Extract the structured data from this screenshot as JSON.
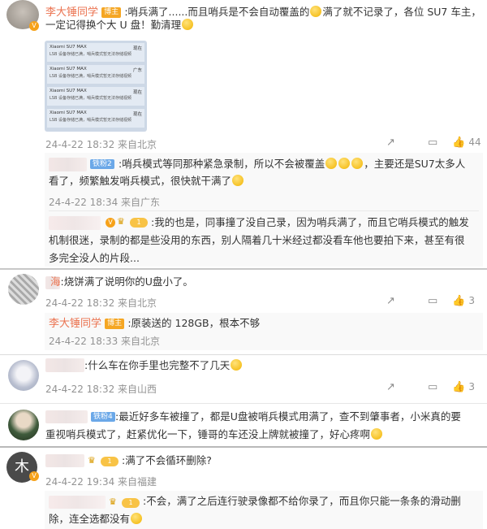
{
  "c1": {
    "name": "李大锤同学",
    "badge": "博主",
    "text_line1": ":哨兵满了......而且哨兵是不会自动覆盖的",
    "text_line1b": "满了就不记录了，各位 SU7 车主，",
    "text_line2": "一定记得换个大 U 盘！勤清理",
    "thumb": {
      "rows": [
        {
          "title": "Xiaomi SU7 MAX",
          "tag": "现在",
          "detail": "LSB 设备存储已满，哨兵模式暂无法存储视频"
        },
        {
          "title": "Xiaomi SU7 MAX",
          "tag": "广东",
          "detail": "LSB 设备存储已满，哨兵模式暂无法存储视频"
        },
        {
          "title": "Xiaomi SU7 MAX",
          "tag": "现在",
          "detail": "LSB 设备存储已满，哨兵模式暂无法存储视频"
        },
        {
          "title": "Xiaomi SU7 MAX",
          "tag": "现在",
          "detail": "LSB 设备存储已满，哨兵模式暂无法存储视频"
        }
      ]
    },
    "time": "24-4-22 18:32 来自北京",
    "likes": "44"
  },
  "r1": {
    "fan_badge": "铁粉2",
    "text_line1": ":哨兵模式等同那种紧急录制，所以不会被覆盖",
    "text_line1b": "，主要还是SU7太多人",
    "text_line2": "看了，频繁触发哨兵模式，很快就干满了",
    "time": "24-4-22 18:34 来自广东"
  },
  "r2": {
    "level": "1",
    "text_line1": ":我的也是，同事撞了没自己录，因为哨兵满了，而且它哨兵模式的触发",
    "text_line2": "机制很迷，录制的都是些没用的东西，别人隔着几十米经过都没看车他也要拍下来，甚至有很",
    "text_line3": "多完全没人的片段..."
  },
  "c2": {
    "name_tail": "海",
    "text": ":烧饼满了说明你的U盘小了。",
    "time": "24-4-22 18:32 来自北京",
    "likes": "3",
    "reply": {
      "name": "李大锤同学",
      "badge": "博主",
      "text": ":原装送的 128GB，根本不够",
      "time": "24-4-22 18:33 来自北京"
    }
  },
  "c3": {
    "text": ":什么车在你手里也完整不了几天",
    "time": "24-4-22 18:32 来自山西",
    "likes": "3"
  },
  "c4": {
    "fan_badge": "铁粉4",
    "text_line1": ":最近好多车被撞了，都是U盘被哨兵模式用满了，查不到肇事者，小米真的要",
    "text_line2": "重视哨兵模式了，赶紧优化一下，锤哥的车还没上牌就被撞了，好心疼啊",
    "avatar_letter": ""
  },
  "c5": {
    "avatar_letter": "木",
    "level": "1",
    "text": ":满了不会循环删除?",
    "time": "24-4-22 19:34 来自福建",
    "reply": {
      "level": "1",
      "text_line1": ":不会，满了之后连行驶录像都不给你录了，而且你只能一条条的滑动删",
      "text_line2": "除，连全选都没有"
    }
  },
  "icons": {
    "share": "share-icon",
    "comment": "comment-icon",
    "like": "like-icon"
  }
}
